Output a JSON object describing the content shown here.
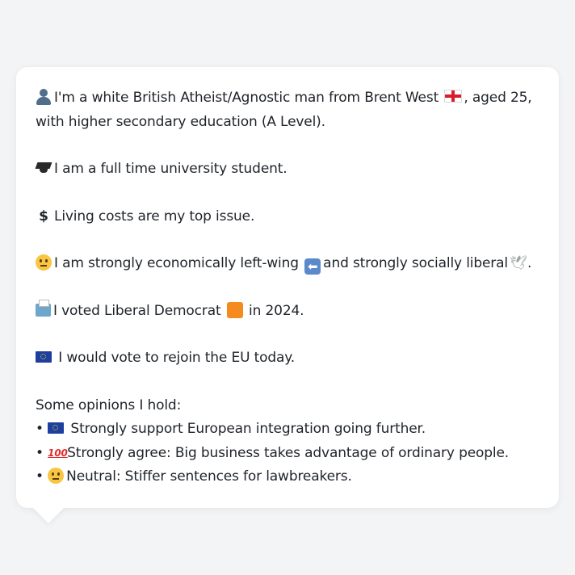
{
  "profile": {
    "line1a": "I'm a white British Atheist/Agnostic man from Brent West",
    "line1b": ", aged 25,",
    "line2": "with higher secondary education (A Level).",
    "student": "I am a full time university student.",
    "issue": "Living costs are my top issue.",
    "politics_a": "I am strongly economically left-wing",
    "politics_b": "and strongly socially liberal",
    "politics_c": ".",
    "vote_a": "I voted Liberal Democrat",
    "vote_b": "in 2024.",
    "eu": "I would vote to rejoin the EU today."
  },
  "opinions": {
    "heading": "Some opinions I hold:",
    "items": [
      "Strongly support European integration going further.",
      "Strongly agree: Big business takes advantage of ordinary people.",
      "Neutral: Stiffer sentences for lawbreakers."
    ],
    "bullet": "•"
  },
  "icons": {
    "person": "bust-in-silhouette-icon",
    "flag_england": "england-flag-icon",
    "cap": "graduation-cap-icon",
    "dollar": "dollar-sign-icon",
    "thinking": "thinking-face-icon",
    "arrow": "left-arrow-icon",
    "dove": "dove-icon",
    "ballot": "ballot-box-icon",
    "square": "orange-square-icon",
    "eu": "eu-flag-icon",
    "hundred": "hundred-points-icon",
    "neutral": "neutral-face-icon"
  },
  "colors": {
    "background": "#f3f4f6",
    "bubble": "#ffffff",
    "text": "#1f2329",
    "lib_dem_orange": "#f58b1f"
  }
}
